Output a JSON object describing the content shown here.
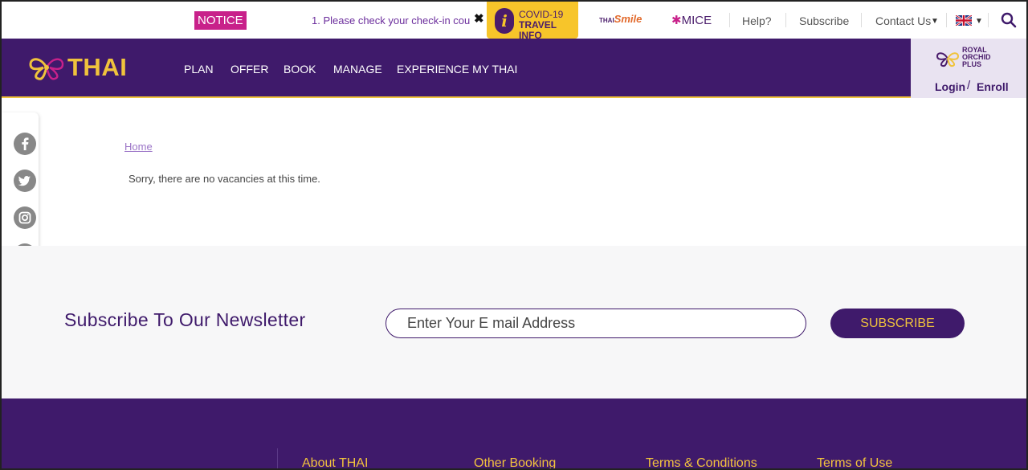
{
  "topbar": {
    "notice_label": "NOTICE",
    "ticker_text": "1. Please check your check-in cou",
    "covid_line1": "COVID-19",
    "covid_line2": "TRAVEL INFO",
    "smile_prefix": "THAI",
    "smile_label": "Smile",
    "mice_label": "MICE",
    "help": "Help?",
    "subscribe": "Subscribe",
    "contact": "Contact Us"
  },
  "nav": {
    "logo": "THAI",
    "items": [
      "PLAN",
      "OFFER",
      "BOOK",
      "MANAGE",
      "EXPERIENCE MY THAI"
    ]
  },
  "rop": {
    "line1": "ROYAL",
    "line2": "ORCHID",
    "line3": "PLUS",
    "login": "Login",
    "slash": "/",
    "enroll": "Enroll"
  },
  "content": {
    "breadcrumb": "Home",
    "message": "Sorry, there are no vacancies at this time."
  },
  "newsletter": {
    "title": "Subscribe To Our Newsletter",
    "placeholder": "Enter Your E mail Address",
    "button": "SUBSCRIBE"
  },
  "footer": {
    "links": [
      "About THAI",
      "Other Booking",
      "Terms & Conditions",
      "Terms of Use"
    ]
  },
  "colors": {
    "brand_purple": "#3f1a6b",
    "brand_gold": "#f0c33c",
    "notice_pink": "#c8218a"
  },
  "icons": [
    "facebook-icon",
    "twitter-icon",
    "instagram-icon",
    "tiktok-icon",
    "youtube-icon",
    "email-icon"
  ]
}
